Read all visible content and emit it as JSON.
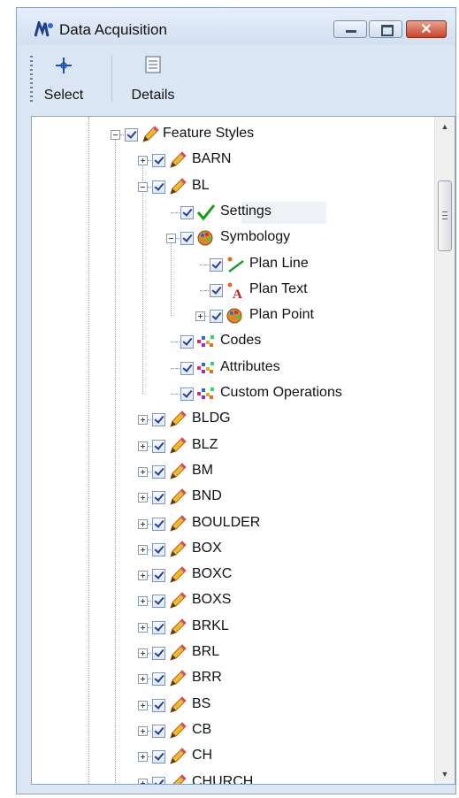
{
  "window": {
    "title": "Data Acquisition"
  },
  "toolbar": {
    "select_label": "Select",
    "details_label": "Details"
  },
  "tree": {
    "root_label": "Feature Styles",
    "feature_items": [
      "BARN",
      "BL",
      "BLDG",
      "BLZ",
      "BM",
      "BND",
      "BOULDER",
      "BOX",
      "BOXC",
      "BOXS",
      "BRKL",
      "BRL",
      "BRR",
      "BS",
      "CB",
      "CH",
      "CHURCH"
    ],
    "bl_children": {
      "settings": "Settings",
      "symbology": "Symbology",
      "plan_line": "Plan Line",
      "plan_text": "Plan Text",
      "plan_point": "Plan Point",
      "codes": "Codes",
      "attributes": "Attributes",
      "custom_operations": "Custom Operations"
    }
  },
  "icons": {
    "window": "data-acquisition-icon",
    "select": "crosshair-icon",
    "details": "details-list-icon",
    "feature": "pencil-icon",
    "settings": "checkmark-icon",
    "symbology": "palette-icon",
    "plan_line": "line-icon",
    "plan_text": "text-a-icon",
    "codes": "multicolor-icon"
  },
  "colors": {
    "accent": "#2b3d8f",
    "close_button": "#c7452b",
    "check": "#1a9a1a"
  }
}
